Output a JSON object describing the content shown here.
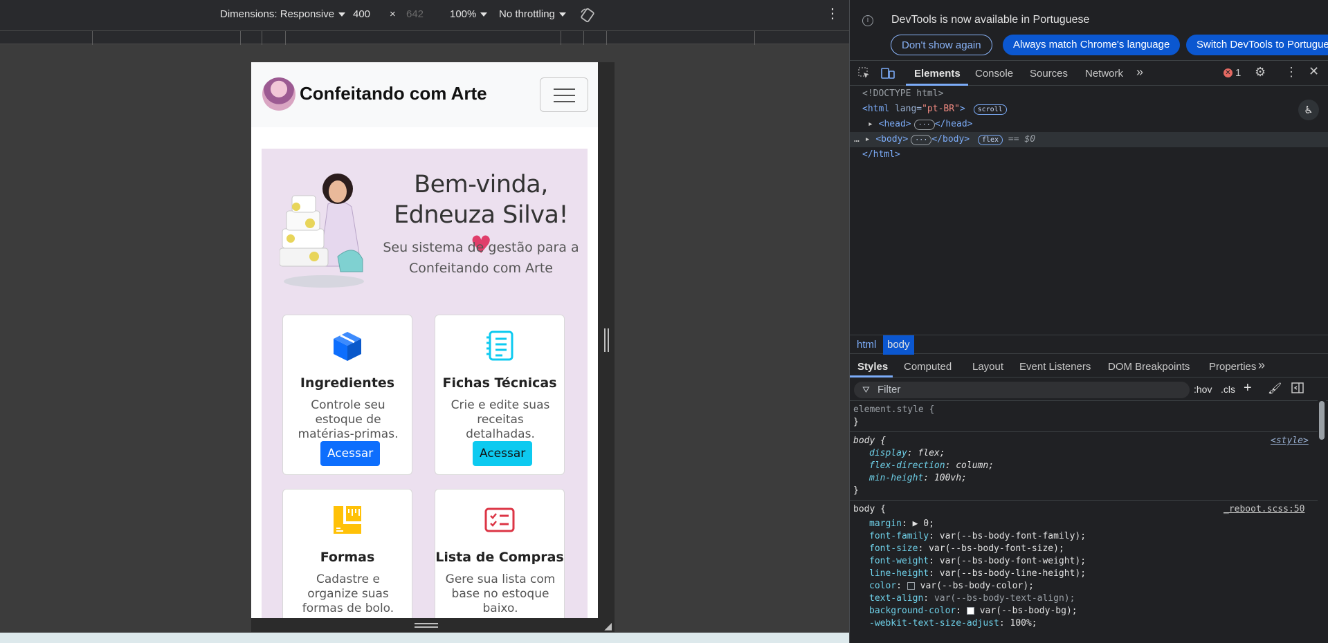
{
  "emulation": {
    "dimensions_label": "Dimensions: Responsive",
    "width": "400",
    "times": "×",
    "height": "642",
    "zoom": "100%",
    "throttling": "No throttling"
  },
  "app": {
    "brand": "Confeitando com Arte",
    "greeting_line1": "Bem-vinda,",
    "greeting_line2": "Edneuza Silva!",
    "heart": "♥",
    "subtitle": "Seu sistema de gestão para a Confeitando com Arte",
    "cards": [
      {
        "title": "Ingredientes",
        "desc": "Controle seu estoque de matérias-primas.",
        "button": "Acessar"
      },
      {
        "title": "Fichas Técnicas",
        "desc": "Crie e edite suas receitas detalhadas.",
        "button": "Acessar"
      },
      {
        "title": "Formas",
        "desc": "Cadastre e organize suas formas de bolo."
      },
      {
        "title": "Lista de Compras",
        "desc": "Gere sua lista com base no estoque baixo."
      }
    ],
    "colors": {
      "primary": "#0d6efd",
      "info": "#0dcaf0",
      "warning": "#ffc107",
      "danger": "#dc3545",
      "hero_bg": "#ece0ef"
    }
  },
  "devtools": {
    "info_text": "DevTools is now available in Portuguese",
    "info_buttons": [
      "Don't show again",
      "Always match Chrome's language",
      "Switch DevTools to Portugue"
    ],
    "tabs": [
      "Elements",
      "Console",
      "Sources",
      "Network"
    ],
    "more": "»",
    "error_count": "1",
    "dom": {
      "doctype": "<!DOCTYPE html>",
      "html_open_tag": "<html",
      "html_attr": " lang=",
      "html_attr_val": "\"pt-BR\"",
      "html_open_end": ">",
      "scroll_pill": "scroll",
      "head": "<head>",
      "head_close": "</head>",
      "body": "<body>",
      "body_close": "</body>",
      "flex_pill": "flex",
      "dollar": "== $0",
      "html_close": "</html>",
      "ellipsis": "…",
      "dots": "···"
    },
    "breadcrumbs": [
      "html",
      "body"
    ],
    "subtabs": [
      "Styles",
      "Computed",
      "Layout",
      "Event Listeners",
      "DOM Breakpoints",
      "Properties"
    ],
    "filter_placeholder": "Filter",
    "filter_opts": [
      ":hov",
      ".cls",
      "+"
    ],
    "styles": {
      "element_style": "element.style {",
      "close_brace": "}",
      "rule1_sel": "body {",
      "rule1_src": "<style>",
      "rule1_props": [
        {
          "p": "display",
          "v": "flex;"
        },
        {
          "p": "flex-direction",
          "v": "column;"
        },
        {
          "p": "min-height",
          "v": "100vh;"
        }
      ],
      "rule2_sel": "body {",
      "rule2_src": "_reboot.scss:50",
      "rule2_props": [
        {
          "p": "margin",
          "v": "▶ 0;"
        },
        {
          "p": "font-family",
          "v": "var(--bs-body-font-family);"
        },
        {
          "p": "font-size",
          "v": "var(--bs-body-font-size);"
        },
        {
          "p": "font-weight",
          "v": "var(--bs-body-font-weight);"
        },
        {
          "p": "line-height",
          "v": "var(--bs-body-line-height);"
        },
        {
          "p": "color",
          "v": "var(--bs-body-color);"
        },
        {
          "p": "text-align",
          "v": "var(--bs-body-text-align);"
        },
        {
          "p": "background-color",
          "v": "var(--bs-body-bg);"
        },
        {
          "p": "-webkit-text-size-adjust",
          "v": "100%;"
        }
      ]
    }
  }
}
